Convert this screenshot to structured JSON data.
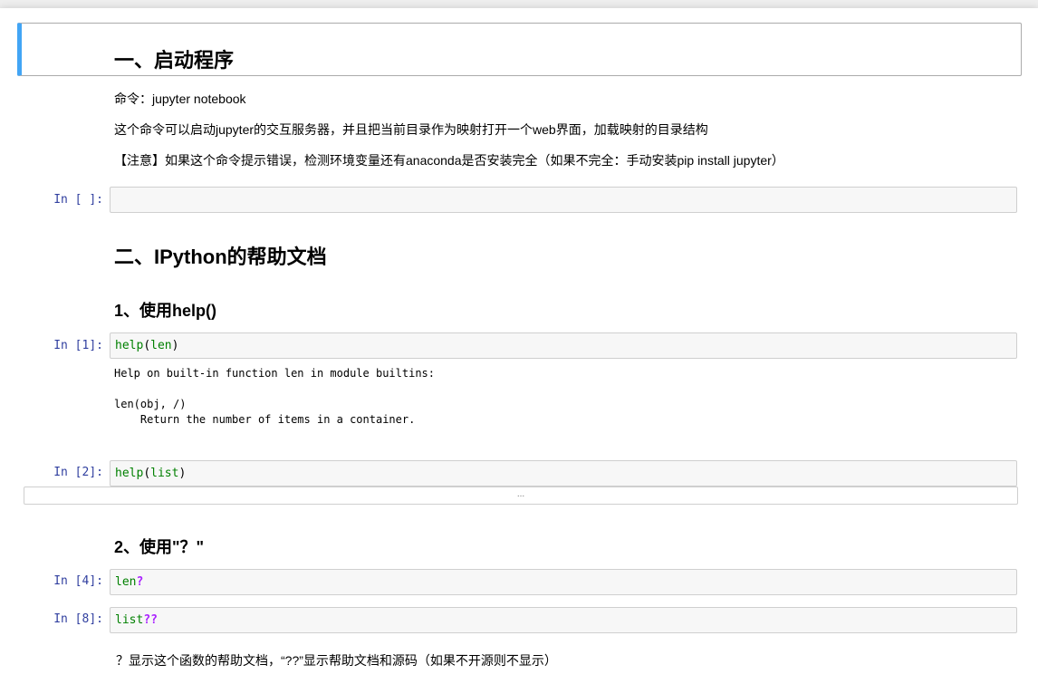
{
  "cells": {
    "h1_start": "一、启动程序",
    "md_command": "命令：jupyter notebook",
    "md_desc": "这个命令可以启动jupyter的交互服务器，并且把当前目录作为映射打开一个web界面，加载映射的目录结构",
    "md_note": "【注意】如果这个命令提示错误，检测环境变量还有anaconda是否安装完全（如果不完全：手动安装pip install jupyter）",
    "empty_prompt": "In [ ]:",
    "h1_ipython": "二、IPython的帮助文档",
    "h2_help": "1、使用help()",
    "cell1_prompt": "In [1]:",
    "cell1_func": "help",
    "cell1_open": "(",
    "cell1_arg": "len",
    "cell1_close": ")",
    "cell1_output": "Help on built-in function len in module builtins:\n\nlen(obj, /)\n    Return the number of items in a container.",
    "cell2_prompt": "In [2]:",
    "cell2_func": "help",
    "cell2_open": "(",
    "cell2_arg": "list",
    "cell2_close": ")",
    "collapsed_output": "...",
    "h2_question": "2、使用\"？\"",
    "cell4_prompt": "In [4]:",
    "cell4_name": "len",
    "cell4_op": "?",
    "cell8_prompt": "In [8]:",
    "cell8_name": "list",
    "cell8_op": "??",
    "md_question_desc": "？显示这个函数的帮助文档，“??”显示帮助文档和源码（如果不开源则不显示）"
  },
  "colors": {
    "prompt": "#303f9f",
    "selected_bar": "#42a5f5",
    "builtin": "#008000",
    "operator": "#aa22ff"
  }
}
